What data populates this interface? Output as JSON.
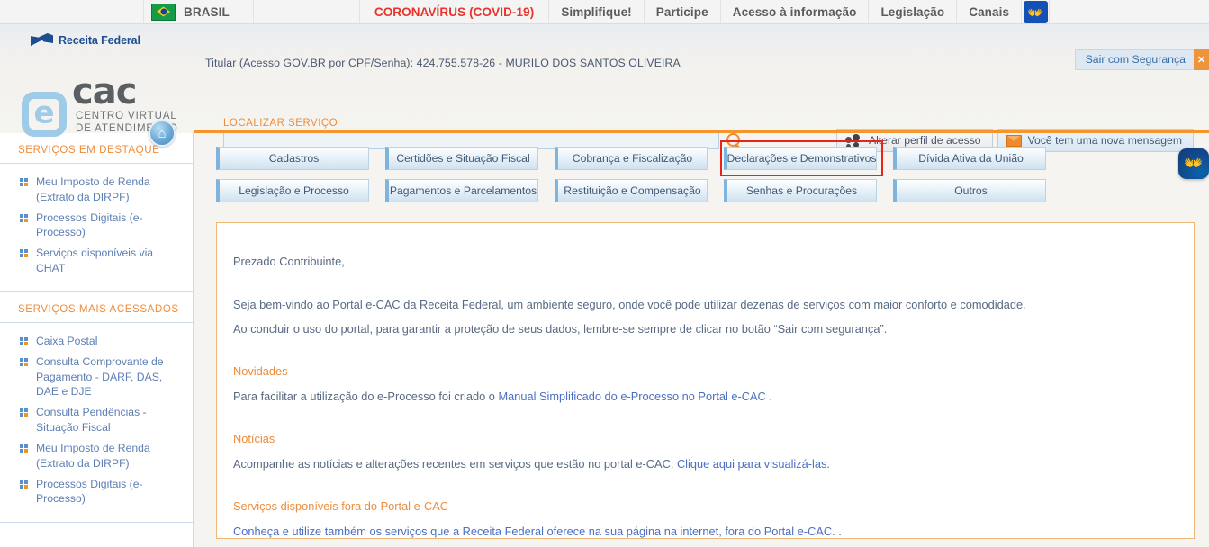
{
  "govbar": {
    "flag_label": "BRASIL",
    "items": [
      {
        "label": "CORONAVÍRUS (COVID-19)",
        "accent": "#e8342b"
      },
      {
        "label": "Simplifique!",
        "accent": ""
      },
      {
        "label": "Participe",
        "accent": ""
      },
      {
        "label": "Acesso à informação",
        "accent": ""
      },
      {
        "label": "Legislação",
        "accent": ""
      },
      {
        "label": "Canais",
        "accent": ""
      }
    ],
    "vlibras_icon": "hands-icon"
  },
  "header": {
    "agency": "Receita Federal",
    "logo_e": "e",
    "logo_cac": "cac",
    "logo_sub_line1": "CENTRO VIRTUAL",
    "logo_sub_line2": "DE ATENDIMENTO",
    "home_icon": "home-icon",
    "titular": "Titular (Acesso GOV.BR por CPF/Senha): 424.755.578-26 - MURILO DOS SANTOS OLIVEIRA",
    "logout_label": "Sair com Segurança",
    "logout_close_icon": "close-icon"
  },
  "search": {
    "label": "LOCALIZAR SERVIÇO",
    "value": "",
    "placeholder": "",
    "icon": "search-icon"
  },
  "header_actions": [
    {
      "label": "Alterar perfil de acesso",
      "icon": "people-icon",
      "style": "default"
    },
    {
      "label": "Você tem uma nova mensagem",
      "icon": "mail-icon",
      "style": "message"
    }
  ],
  "sidebar": {
    "groups": [
      {
        "title": "SERVIÇOS EM DESTAQUE",
        "items": [
          "Meu Imposto de Renda (Extrato da DIRPF)",
          "Processos Digitais (e-Processo)",
          "Serviços disponíveis via CHAT"
        ]
      },
      {
        "title": "SERVIÇOS MAIS ACESSADOS",
        "items": [
          "Caixa Postal",
          "Consulta Comprovante de Pagamento - DARF, DAS, DAE e DJE",
          "Consulta Pendências - Situação Fiscal",
          "Meu Imposto de Renda (Extrato da DIRPF)",
          "Processos Digitais (e-Processo)"
        ]
      }
    ]
  },
  "categories": [
    {
      "label": "Cadastros",
      "highlighted": false
    },
    {
      "label": "Certidões e Situação Fiscal",
      "highlighted": false
    },
    {
      "label": "Cobrança e Fiscalização",
      "highlighted": false
    },
    {
      "label": "Declarações e Demonstrativos",
      "highlighted": true
    },
    {
      "label": "Dívida Ativa da União",
      "highlighted": false
    },
    {
      "label": "Legislação e Processo",
      "highlighted": false
    },
    {
      "label": "Pagamentos e Parcelamentos",
      "highlighted": false
    },
    {
      "label": "Restituição e Compensação",
      "highlighted": false
    },
    {
      "label": "Senhas e Procurações",
      "highlighted": false
    },
    {
      "label": "Outros",
      "highlighted": false
    }
  ],
  "content": {
    "greeting": "Prezado Contribuinte,",
    "welcome": "Seja bem-vindo ao Portal e-CAC da Receita Federal, um ambiente seguro, onde você pode utilizar dezenas de serviços com maior conforto e comodidade.",
    "advice": "Ao concluir o uso do portal, para garantir a proteção de seus dados, lembre-se sempre de clicar no botão “Sair com segurança”.",
    "novidades_title": "Novidades",
    "novidades_text_before": "Para facilitar a utilização do e-Processo foi criado o ",
    "novidades_link": "Manual Simplificado do e-Processo no Portal e-CAC",
    "novidades_text_after": " .",
    "noticias_title": "Notícias",
    "noticias_text_before": "Acompanhe as notícias e alterações recentes em serviços que estão no portal e-CAC. ",
    "noticias_link": "Clique aqui para visualizá-las.",
    "fora_title": "Serviços disponíveis fora do Portal e-CAC",
    "fora_link": "Conheça e utilize também os serviços que a Receita Federal oferece na sua página na internet, fora do Portal e-CAC.",
    "fora_text_after": " ."
  },
  "floating": {
    "accessibility_icon": "hands-icon"
  },
  "colors": {
    "orange": "#f5952b",
    "link_blue": "#4a6fc4",
    "highlight_red": "#e8241a",
    "gov_blue": "#1351b4"
  }
}
